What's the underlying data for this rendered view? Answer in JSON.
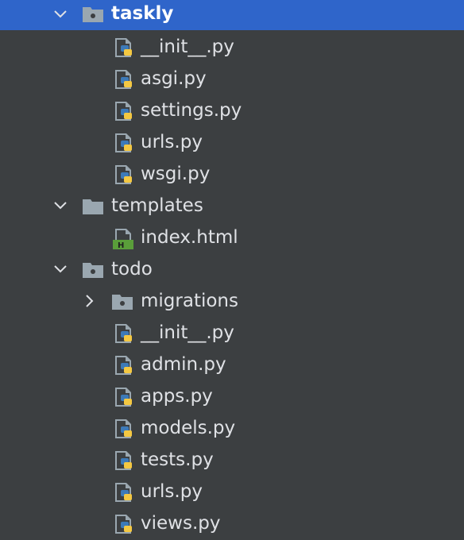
{
  "colors": {
    "background": "#3c3f41",
    "selection": "#2f65ca",
    "text": "#dfe1e5",
    "folder": "#9aa7b0",
    "python_blue": "#3d7ab8",
    "python_yellow": "#f4c842",
    "html_badge": "#5a9e3a"
  },
  "tree": {
    "taskly": {
      "name": "taskly",
      "expanded": true,
      "selected": true,
      "icon": "package-folder-icon",
      "files": [
        "__init__.py",
        "asgi.py",
        "settings.py",
        "urls.py",
        "wsgi.py"
      ]
    },
    "templates": {
      "name": "templates",
      "expanded": true,
      "icon": "folder-icon",
      "files": [
        "index.html"
      ]
    },
    "todo": {
      "name": "todo",
      "expanded": true,
      "icon": "package-folder-icon",
      "migrations": {
        "name": "migrations",
        "expanded": false,
        "icon": "package-folder-icon"
      },
      "files": [
        "__init__.py",
        "admin.py",
        "apps.py",
        "models.py",
        "tests.py",
        "urls.py",
        "views.py"
      ]
    }
  },
  "icons": {
    "python_file": "python-file-icon",
    "html_file": "html-file-icon",
    "html_badge_letter": "H",
    "chevron_open": "chevron-down-icon",
    "chevron_closed": "chevron-right-icon"
  }
}
